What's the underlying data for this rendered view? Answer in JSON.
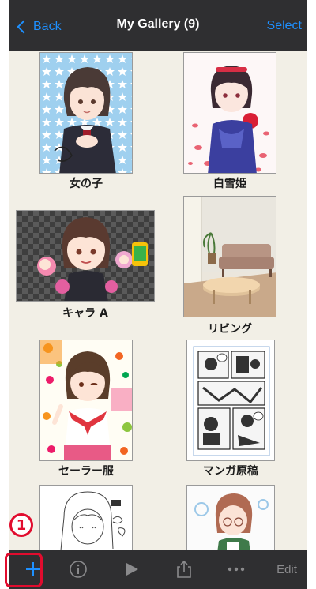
{
  "navbar": {
    "back_label": "Back",
    "title": "My Gallery (9)",
    "select_label": "Select"
  },
  "gallery": {
    "items": [
      {
        "caption": "女の子"
      },
      {
        "caption": "白雪姫"
      },
      {
        "caption": "キャラ A"
      },
      {
        "caption": "リビング"
      },
      {
        "caption": "セーラー服"
      },
      {
        "caption": "マンガ原稿"
      },
      {
        "caption": ""
      },
      {
        "caption": ""
      }
    ]
  },
  "toolbar": {
    "add_icon": "plus-icon",
    "info_icon": "info-icon",
    "play_icon": "play-icon",
    "share_icon": "share-icon",
    "more_icon": "more-icon",
    "edit_label": "Edit"
  },
  "annotation": {
    "step_number": "1"
  },
  "colors": {
    "accent": "#1e90ff",
    "bar": "#2f2f31",
    "background": "#f2efe6",
    "highlight": "#e10c2e"
  }
}
